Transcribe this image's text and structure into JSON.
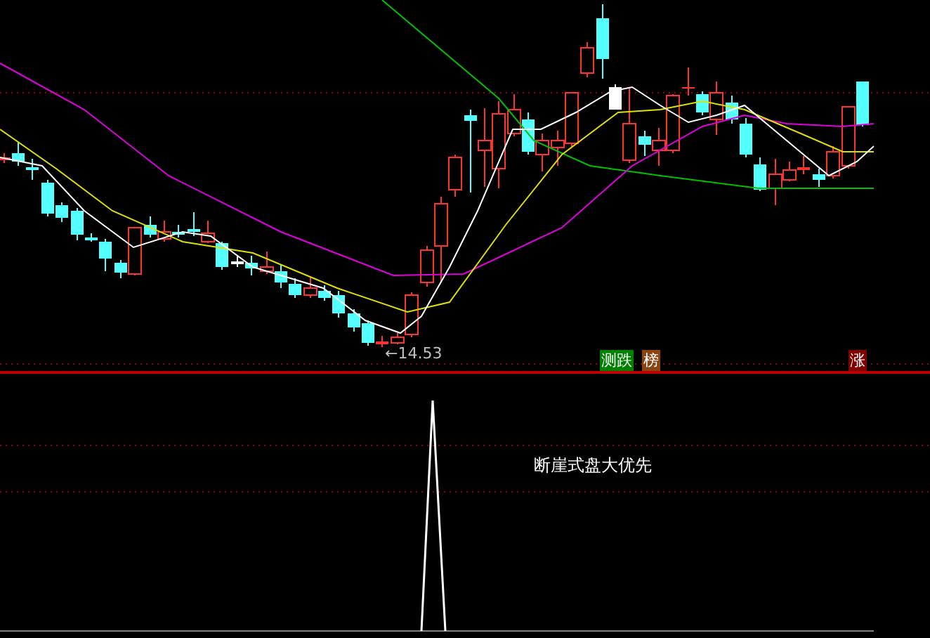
{
  "price_chart": {
    "low_marker": "←14.53",
    "signal_tags": [
      {
        "label": "测跌",
        "color": "#008000"
      },
      {
        "label": "榜",
        "color": "#8b4513"
      },
      {
        "label": "涨",
        "color": "#800000"
      }
    ]
  },
  "indicator_panel": {
    "caption": "断崖式盘大优先"
  }
}
